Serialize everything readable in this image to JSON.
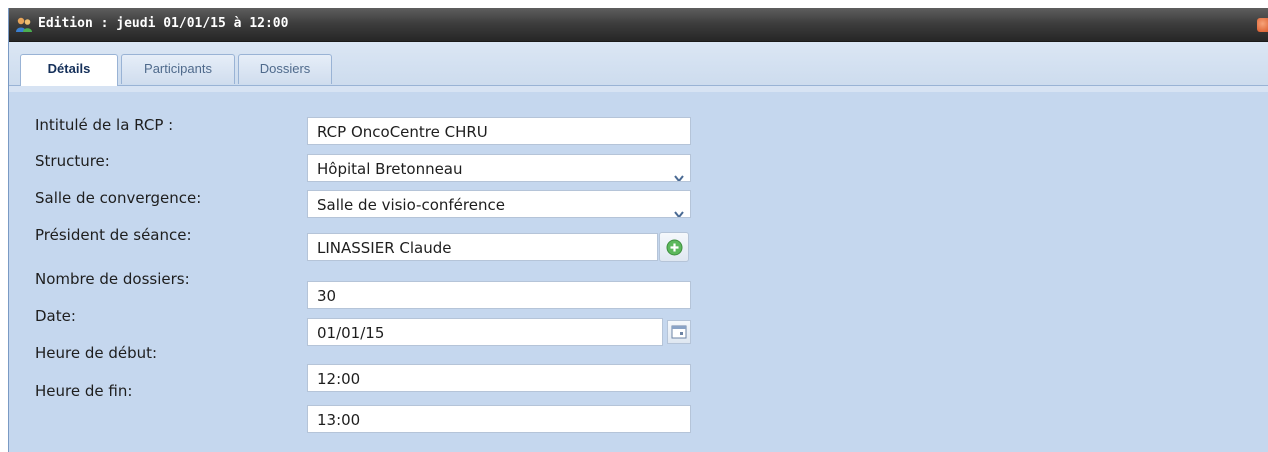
{
  "window": {
    "title": "Edition : jeudi 01/01/15 à 12:00",
    "icon": "users-icon",
    "close_icon": "close-icon"
  },
  "tabs": [
    {
      "label": "Détails",
      "active": true
    },
    {
      "label": "Participants",
      "active": false
    },
    {
      "label": "Dossiers",
      "active": false
    }
  ],
  "form": {
    "intitule": {
      "label": "Intitulé de la RCP :",
      "value": "RCP OncoCentre CHRU"
    },
    "structure": {
      "label": "Structure:",
      "value": "Hôpital Bretonneau"
    },
    "salle": {
      "label": "Salle de convergence:",
      "value": "Salle de visio-conférence"
    },
    "president": {
      "label": "Président de séance:",
      "value": "LINASSIER Claude",
      "button_icon": "add-icon"
    },
    "nombre": {
      "label": "Nombre de dossiers:",
      "value": "30"
    },
    "date": {
      "label": "Date:",
      "value": "01/01/15",
      "button_icon": "calendar-icon"
    },
    "heure_debut": {
      "label": "Heure de début:",
      "value": "12:00"
    },
    "heure_fin": {
      "label": "Heure de fin:",
      "value": "13:00"
    }
  },
  "colors": {
    "panel_bg": "#c5d7ee",
    "titlebar": "#3a3a3a",
    "add_green": "#5cb85c"
  }
}
